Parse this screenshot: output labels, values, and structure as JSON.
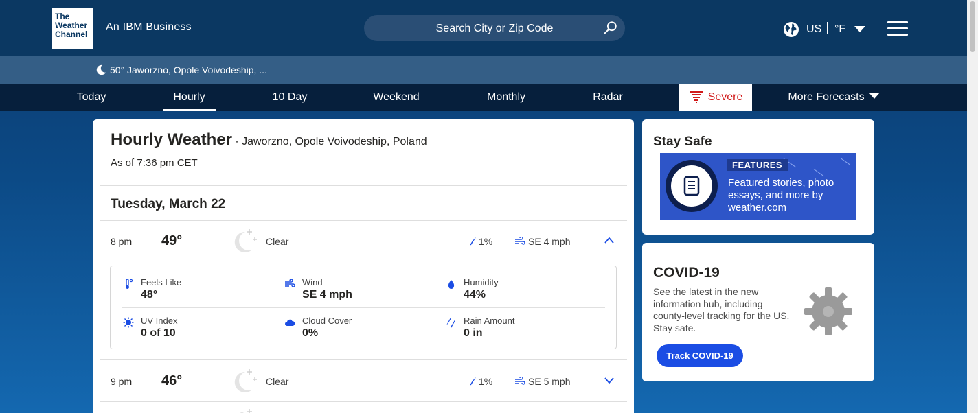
{
  "header": {
    "logo_lines": [
      "The",
      "Weather",
      "Channel"
    ],
    "tagline": "An IBM Business",
    "search_placeholder": "Search City or Zip Code",
    "country": "US",
    "unit": "°F"
  },
  "location_bar": {
    "current": "50° Jaworzno, Opole Voivodeship, ..."
  },
  "nav": {
    "items": [
      "Today",
      "Hourly",
      "10 Day",
      "Weekend",
      "Monthly",
      "Radar",
      "Severe",
      "More Forecasts"
    ],
    "active": "Hourly"
  },
  "main": {
    "title": "Hourly Weather",
    "location": " - Jaworzno, Opole Voivodeship, Poland",
    "as_of": "As of 7:36 pm CET",
    "day": "Tuesday, March 22",
    "hours": [
      {
        "time": "8 pm",
        "temp": "49°",
        "condition": "Clear",
        "precip": "1%",
        "wind": "SE 4 mph",
        "expanded": true
      },
      {
        "time": "9 pm",
        "temp": "46°",
        "condition": "Clear",
        "precip": "1%",
        "wind": "SE 5 mph",
        "expanded": false
      }
    ],
    "details": {
      "feels_like": {
        "label": "Feels Like",
        "value": "48°"
      },
      "wind": {
        "label": "Wind",
        "value": "SE 4 mph"
      },
      "humidity": {
        "label": "Humidity",
        "value": "44%"
      },
      "uv": {
        "label": "UV Index",
        "value": "0 of 10"
      },
      "cloud": {
        "label": "Cloud Cover",
        "value": "0%"
      },
      "rain": {
        "label": "Rain Amount",
        "value": "0 in"
      }
    }
  },
  "sidebar": {
    "stay_safe": {
      "title": "Stay Safe",
      "tag": "FEATURES",
      "text": "Featured stories, photo essays, and more by weather.com"
    },
    "covid": {
      "title": "COVID-19",
      "text": "See the latest in the new information hub, including county-level tracking for the US. Stay safe.",
      "button": "Track COVID-19"
    }
  },
  "colors": {
    "header_bg": "#0b3862",
    "nav_bg": "#061f3c",
    "accent_blue": "#1b4de4",
    "severe_red": "#d11a1a"
  }
}
